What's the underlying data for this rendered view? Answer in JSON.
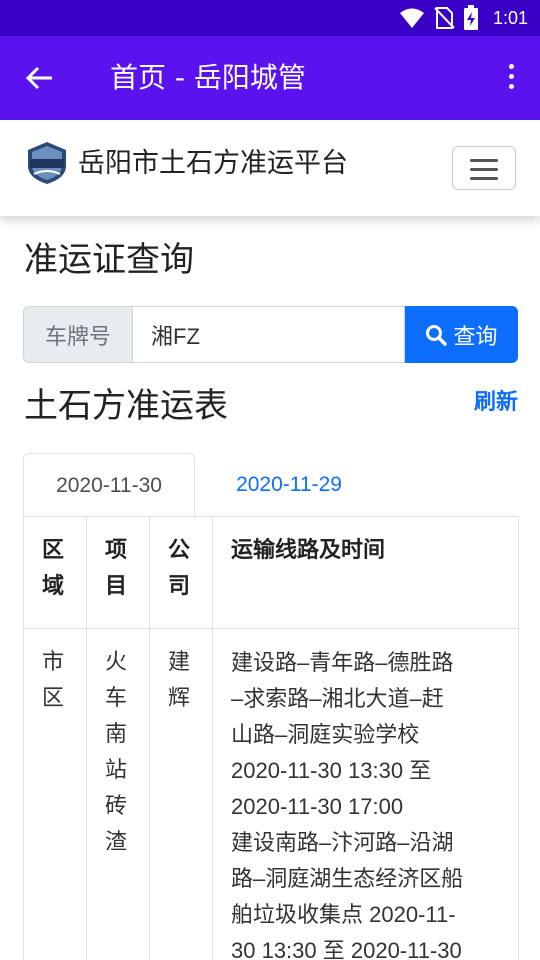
{
  "status_bar": {
    "time": "1:01",
    "icons": [
      "wifi-icon",
      "no-sim-icon",
      "battery-charging-icon"
    ]
  },
  "app_bar": {
    "title": "首页 - 岳阳城管"
  },
  "site": {
    "logo_text": "城管执法",
    "brand": "岳阳市土石方准运平台"
  },
  "page_title": "准运证查询",
  "search": {
    "label": "车牌号",
    "value": "湘FZ",
    "button": "查询"
  },
  "section_title": "土石方准运表",
  "refresh_label": "刷新",
  "tabs": [
    {
      "label": "2020-11-30",
      "active": true
    },
    {
      "label": "2020-11-29",
      "active": false
    }
  ],
  "table": {
    "headers": [
      "区域",
      "项目",
      "公司",
      "运输线路及时间"
    ],
    "rows": [
      {
        "region": "市区",
        "project": "火车南站砖渣",
        "company": "建辉",
        "routes": [
          "建设路–青年路–德胜路",
          "–求索路–湘北大道–赶",
          "山路–洞庭实验学校",
          "2020-11-30 13:30 至",
          "2020-11-30 17:00",
          "建设南路–汴河路–沿湖",
          "路–洞庭湖生态经济区船",
          "舶垃圾收集点 2020-11-",
          "30 13:30 至 2020-11-30"
        ]
      }
    ]
  },
  "colors": {
    "status_bar": "#3a00c6",
    "app_bar": "#5a12ee",
    "primary": "#0d6efd"
  }
}
